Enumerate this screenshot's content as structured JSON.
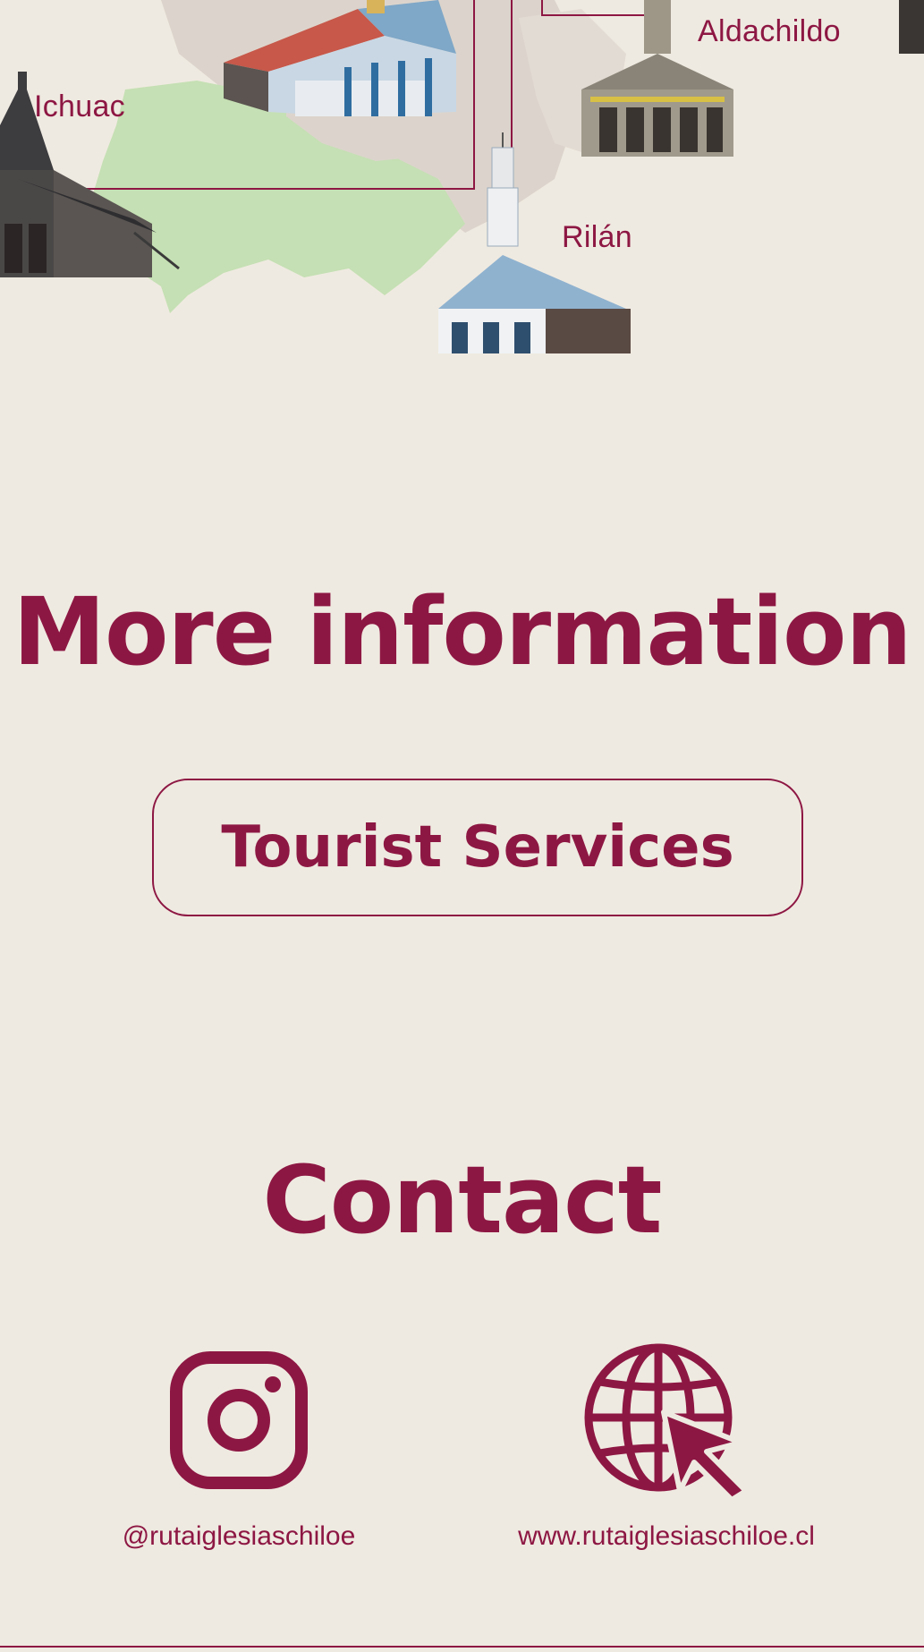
{
  "map": {
    "places": [
      "Ichuac",
      "Aldachildo",
      "Rilán"
    ]
  },
  "more_info": {
    "title": "More information",
    "tourist_services_label": "Tourist Services"
  },
  "contact": {
    "title": "Contact",
    "instagram_handle": "@rutaiglesiaschiloe",
    "website": "www.rutaiglesiaschiloe.cl",
    "instagram_icon": "instagram-icon",
    "website_icon": "globe-cursor-icon"
  },
  "colors": {
    "accent": "#8d1743",
    "background": "#efeae1",
    "map_green": "#c5e0b4",
    "map_land": "#dcd4cc"
  }
}
